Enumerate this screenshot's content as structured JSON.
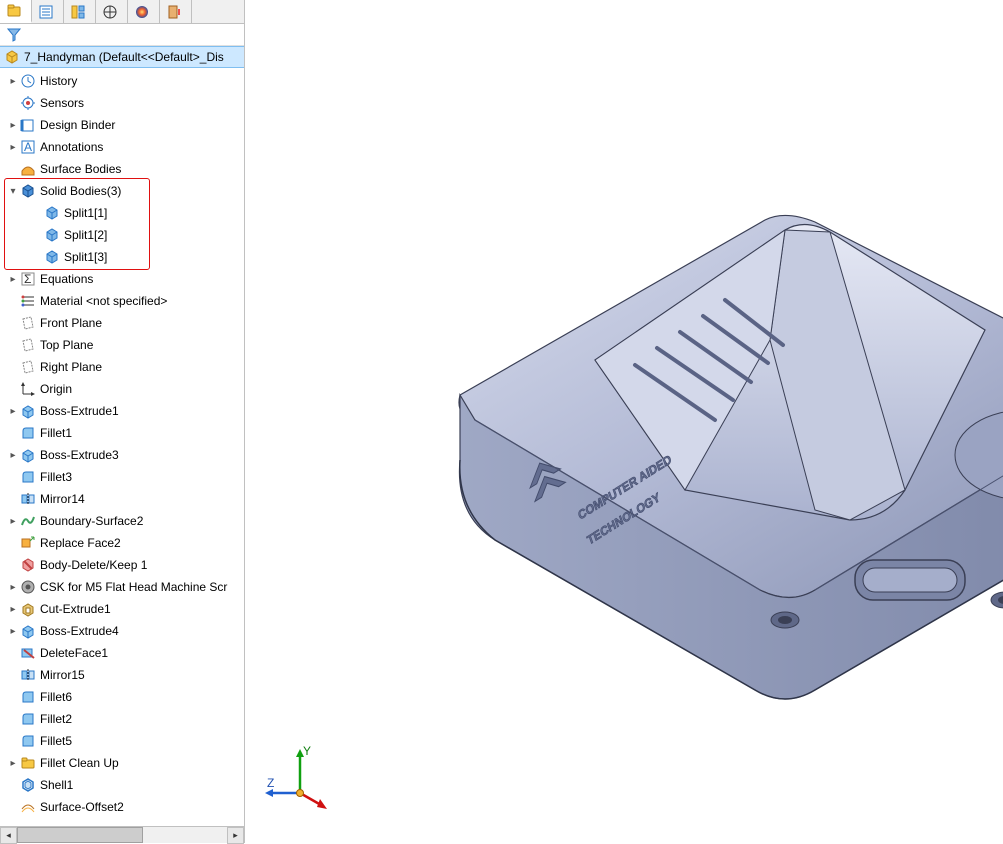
{
  "tabs": {
    "feature_manager": "feature-manager",
    "property_manager": "property-manager",
    "config_manager": "config-manager",
    "dimxpert": "dimxpert",
    "display_manager": "display-manager",
    "cam_manager": "cam-manager"
  },
  "root": {
    "label": "7_Handyman  (Default<<Default>_Dis"
  },
  "tree": [
    {
      "exp": "▸",
      "icon": "history",
      "label": "History",
      "indent": 1
    },
    {
      "exp": "",
      "icon": "sensors",
      "label": "Sensors",
      "indent": 1
    },
    {
      "exp": "▸",
      "icon": "binder",
      "label": "Design Binder",
      "indent": 1
    },
    {
      "exp": "▸",
      "icon": "annot",
      "label": "Annotations",
      "indent": 1
    },
    {
      "exp": "",
      "icon": "surface",
      "label": "Surface Bodies",
      "indent": 1
    },
    {
      "exp": "▾",
      "icon": "solid",
      "label": "Solid Bodies(3)",
      "indent": 1
    },
    {
      "exp": "",
      "icon": "body",
      "label": "Split1[1]",
      "indent": 2
    },
    {
      "exp": "",
      "icon": "body",
      "label": "Split1[2]",
      "indent": 2
    },
    {
      "exp": "",
      "icon": "body",
      "label": "Split1[3]",
      "indent": 2
    },
    {
      "exp": "▸",
      "icon": "sigma",
      "label": "Equations",
      "indent": 1
    },
    {
      "exp": "",
      "icon": "material",
      "label": "Material <not specified>",
      "indent": 1
    },
    {
      "exp": "",
      "icon": "plane",
      "label": "Front Plane",
      "indent": 1
    },
    {
      "exp": "",
      "icon": "plane",
      "label": "Top Plane",
      "indent": 1
    },
    {
      "exp": "",
      "icon": "plane",
      "label": "Right Plane",
      "indent": 1
    },
    {
      "exp": "",
      "icon": "origin",
      "label": "Origin",
      "indent": 1
    },
    {
      "exp": "▸",
      "icon": "extrude",
      "label": "Boss-Extrude1",
      "indent": 1
    },
    {
      "exp": "",
      "icon": "fillet",
      "label": "Fillet1",
      "indent": 1
    },
    {
      "exp": "▸",
      "icon": "extrude",
      "label": "Boss-Extrude3",
      "indent": 1
    },
    {
      "exp": "",
      "icon": "fillet",
      "label": "Fillet3",
      "indent": 1
    },
    {
      "exp": "",
      "icon": "mirror",
      "label": "Mirror14",
      "indent": 1
    },
    {
      "exp": "▸",
      "icon": "boundary",
      "label": "Boundary-Surface2",
      "indent": 1
    },
    {
      "exp": "",
      "icon": "replace",
      "label": "Replace Face2",
      "indent": 1
    },
    {
      "exp": "",
      "icon": "delete",
      "label": "Body-Delete/Keep 1",
      "indent": 1
    },
    {
      "exp": "▸",
      "icon": "csk",
      "label": "CSK for M5 Flat Head Machine Scr",
      "indent": 1
    },
    {
      "exp": "▸",
      "icon": "cut",
      "label": "Cut-Extrude1",
      "indent": 1
    },
    {
      "exp": "▸",
      "icon": "extrude",
      "label": "Boss-Extrude4",
      "indent": 1
    },
    {
      "exp": "",
      "icon": "delface",
      "label": "DeleteFace1",
      "indent": 1
    },
    {
      "exp": "",
      "icon": "mirror",
      "label": "Mirror15",
      "indent": 1
    },
    {
      "exp": "",
      "icon": "fillet",
      "label": "Fillet6",
      "indent": 1
    },
    {
      "exp": "",
      "icon": "fillet",
      "label": "Fillet2",
      "indent": 1
    },
    {
      "exp": "",
      "icon": "fillet",
      "label": "Fillet5",
      "indent": 1
    },
    {
      "exp": "▸",
      "icon": "folder",
      "label": "Fillet Clean Up",
      "indent": 1
    },
    {
      "exp": "",
      "icon": "shell",
      "label": "Shell1",
      "indent": 1
    },
    {
      "exp": "",
      "icon": "offset",
      "label": "Surface-Offset2",
      "indent": 1
    }
  ],
  "triad": {
    "x_label": "Z",
    "y_label": "Y"
  },
  "part_text": {
    "line1": "COMPUTER AIDED",
    "line2": "TECHNOLOGY"
  },
  "colors": {
    "part_light": "#bfc6dc",
    "part_mid": "#9fa8c4",
    "part_dark": "#6f789a",
    "edge": "#3a3f55"
  }
}
